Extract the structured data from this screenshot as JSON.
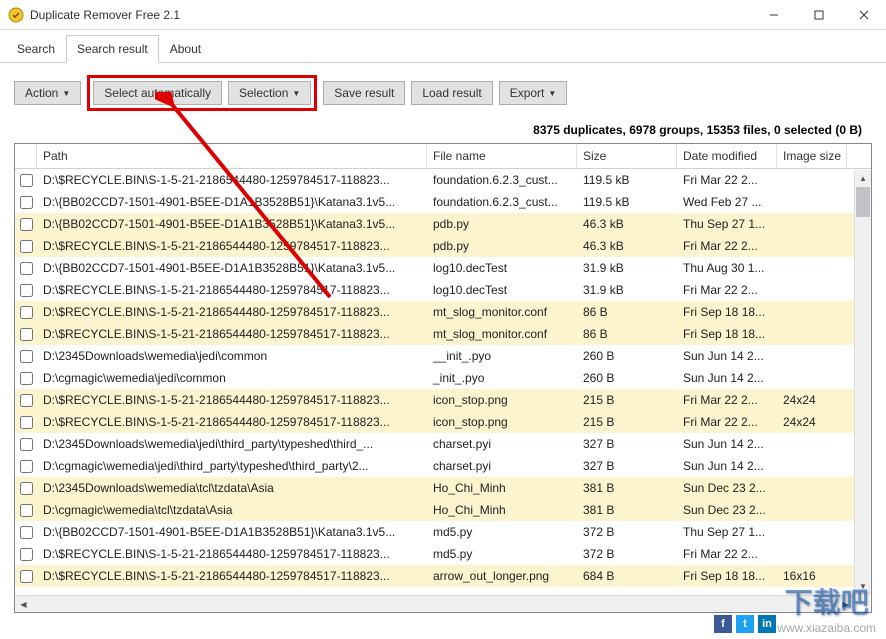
{
  "window": {
    "title": "Duplicate Remover Free 2.1"
  },
  "tabs": {
    "search": "Search",
    "search_result": "Search result",
    "about": "About"
  },
  "toolbar": {
    "action": "Action",
    "select_auto": "Select automatically",
    "selection": "Selection",
    "save_result": "Save result",
    "load_result": "Load result",
    "export": "Export"
  },
  "status": "8375 duplicates, 6978 groups, 15353 files, 0 selected (0 B)",
  "headers": {
    "path": "Path",
    "filename": "File name",
    "size": "Size",
    "date": "Date modified",
    "imgsize": "Image size"
  },
  "rows": [
    {
      "hl": false,
      "path": "D:\\$RECYCLE.BIN\\S-1-5-21-2186544480-1259784517-118823...",
      "fname": "foundation.6.2.3_cust...",
      "size": "119.5 kB",
      "date": "Fri Mar 22 2...",
      "img": ""
    },
    {
      "hl": false,
      "path": "D:\\{BB02CCD7-1501-4901-B5EE-D1A1B3528B51}\\Katana3.1v5...",
      "fname": "foundation.6.2.3_cust...",
      "size": "119.5 kB",
      "date": "Wed Feb 27 ...",
      "img": ""
    },
    {
      "hl": true,
      "path": "D:\\{BB02CCD7-1501-4901-B5EE-D1A1B3528B51}\\Katana3.1v5...",
      "fname": "pdb.py",
      "size": "46.3 kB",
      "date": "Thu Sep 27 1...",
      "img": ""
    },
    {
      "hl": true,
      "path": "D:\\$RECYCLE.BIN\\S-1-5-21-2186544480-1259784517-118823...",
      "fname": "pdb.py",
      "size": "46.3 kB",
      "date": "Fri Mar 22 2...",
      "img": ""
    },
    {
      "hl": false,
      "path": "D:\\{BB02CCD7-1501-4901-B5EE-D1A1B3528B51}\\Katana3.1v5...",
      "fname": "log10.decTest",
      "size": "31.9 kB",
      "date": "Thu Aug 30 1...",
      "img": ""
    },
    {
      "hl": false,
      "path": "D:\\$RECYCLE.BIN\\S-1-5-21-2186544480-1259784517-118823...",
      "fname": "log10.decTest",
      "size": "31.9 kB",
      "date": "Fri Mar 22 2...",
      "img": ""
    },
    {
      "hl": true,
      "path": "D:\\$RECYCLE.BIN\\S-1-5-21-2186544480-1259784517-118823...",
      "fname": "mt_slog_monitor.conf",
      "size": "86 B",
      "date": "Fri Sep 18 18...",
      "img": ""
    },
    {
      "hl": true,
      "path": "D:\\$RECYCLE.BIN\\S-1-5-21-2186544480-1259784517-118823...",
      "fname": "mt_slog_monitor.conf",
      "size": "86 B",
      "date": "Fri Sep 18 18...",
      "img": ""
    },
    {
      "hl": false,
      "path": "D:\\2345Downloads\\wemedia\\jedi\\common",
      "fname": "__init_.pyo",
      "size": "260 B",
      "date": "Sun Jun 14 2...",
      "img": ""
    },
    {
      "hl": false,
      "path": "D:\\cgmagic\\wemedia\\jedi\\common",
      "fname": "_init_.pyo",
      "size": "260 B",
      "date": "Sun Jun 14 2...",
      "img": ""
    },
    {
      "hl": true,
      "path": "D:\\$RECYCLE.BIN\\S-1-5-21-2186544480-1259784517-118823...",
      "fname": "icon_stop.png",
      "size": "215 B",
      "date": "Fri Mar 22 2...",
      "img": "24x24"
    },
    {
      "hl": true,
      "path": "D:\\$RECYCLE.BIN\\S-1-5-21-2186544480-1259784517-118823...",
      "fname": "icon_stop.png",
      "size": "215 B",
      "date": "Fri Mar 22 2...",
      "img": "24x24"
    },
    {
      "hl": false,
      "path": "D:\\2345Downloads\\wemedia\\jedi\\third_party\\typeshed\\third_...",
      "fname": "charset.pyi",
      "size": "327 B",
      "date": "Sun Jun 14 2...",
      "img": ""
    },
    {
      "hl": false,
      "path": "D:\\cgmagic\\wemedia\\jedi\\third_party\\typeshed\\third_party\\2...",
      "fname": "charset.pyi",
      "size": "327 B",
      "date": "Sun Jun 14 2...",
      "img": ""
    },
    {
      "hl": true,
      "path": "D:\\2345Downloads\\wemedia\\tcl\\tzdata\\Asia",
      "fname": "Ho_Chi_Minh",
      "size": "381 B",
      "date": "Sun Dec 23 2...",
      "img": ""
    },
    {
      "hl": true,
      "path": "D:\\cgmagic\\wemedia\\tcl\\tzdata\\Asia",
      "fname": "Ho_Chi_Minh",
      "size": "381 B",
      "date": "Sun Dec 23 2...",
      "img": ""
    },
    {
      "hl": false,
      "path": "D:\\{BB02CCD7-1501-4901-B5EE-D1A1B3528B51}\\Katana3.1v5...",
      "fname": "md5.py",
      "size": "372 B",
      "date": "Thu Sep 27 1...",
      "img": ""
    },
    {
      "hl": false,
      "path": "D:\\$RECYCLE.BIN\\S-1-5-21-2186544480-1259784517-118823...",
      "fname": "md5.py",
      "size": "372 B",
      "date": "Fri Mar 22 2...",
      "img": ""
    },
    {
      "hl": true,
      "path": "D:\\$RECYCLE.BIN\\S-1-5-21-2186544480-1259784517-118823...",
      "fname": "arrow_out_longer.png",
      "size": "684 B",
      "date": "Fri Sep 18 18...",
      "img": "16x16"
    }
  ],
  "watermark": {
    "logo": "下载吧",
    "url": "www.xiazaiba.com"
  }
}
